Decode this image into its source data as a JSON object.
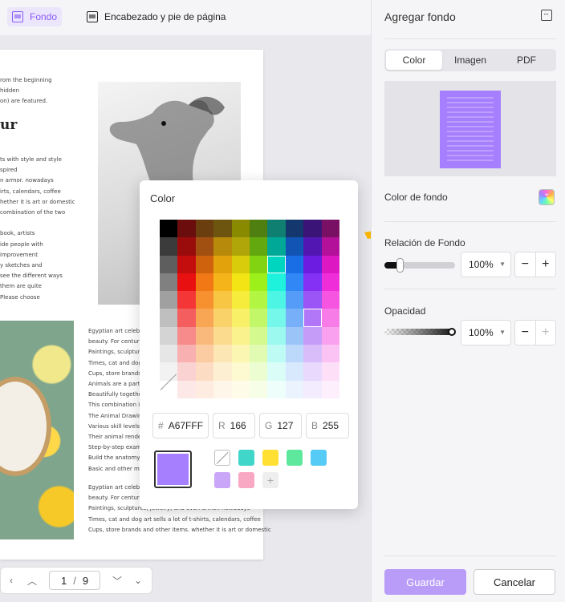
{
  "toolbar": {
    "background_label": "Fondo",
    "header_footer_label": "Encabezado y pie de página"
  },
  "document": {
    "text_top": "rom the beginning\nhidden\non) are featured.",
    "heading": "ur",
    "text_left": "ts with style and style\nspired\nn armor. nowadays\nirts, calendars, coffee\nhether it is art or domestic\ncombination of the two\n\nbook, artists\nide people with\nimprovement\ny sketches and\nsee the different ways\nthem are quite\nPlease choose",
    "text_bottom": "Egyptian art celebrat\nbeauty. For centuries\nPaintings, sculptures\nTimes, cat and dog ar\nCups, store brands ar\nAnimals are a part of\nBeautifully together.\nThis combination is a\nThe Animal Drawing co\nVarious skill levels, s\nTheir animal renderi\nStep-by-step example\nBuild the anatomy of\nBasic and other more",
    "text_footer": "Egyptian art celebrated animals like cats with style and style\nbeauty. For centuries, they have inspired\nPaintings, sculptures, jewelry, and even armor. nowadays\nTimes, cat and dog art sells a lot of t-shirts, calendars, coffee\nCups, store brands and other items. whether it is art or domestic"
  },
  "pager": {
    "current": "1",
    "separator": "/",
    "total": "9"
  },
  "color_popup": {
    "title": "Color",
    "hex_label": "#",
    "hex_value": "A67FFF",
    "r_label": "R",
    "r_value": "166",
    "g_label": "G",
    "g_value": "127",
    "b_label": "B",
    "b_value": "255",
    "selected_color": "#A67FFF",
    "recent_colors": [
      "#40d6c9",
      "#ffe033",
      "#5ee89d",
      "#56cbf5",
      "#c9a6f7",
      "#f9a8c4"
    ],
    "palette": [
      [
        "#000000",
        "#6b0d0d",
        "#6b3e10",
        "#6d5510",
        "#8a8a00",
        "#4f7f10",
        "#0f7f72",
        "#14386e",
        "#3a1476",
        "#7a1063"
      ],
      [
        "#3b3b3b",
        "#9a0c0c",
        "#a15012",
        "#b88a0c",
        "#b0a60a",
        "#63a80f",
        "#00a897",
        "#1254b4",
        "#5216b2",
        "#b3119a"
      ],
      [
        "#5e5e5e",
        "#c40e0e",
        "#cf620c",
        "#e2a20b",
        "#d9cc0a",
        "#82d311",
        "#00d5bf",
        "#196de5",
        "#6b1ce0",
        "#dd17c1"
      ],
      [
        "#808080",
        "#e81010",
        "#f27715",
        "#f5b419",
        "#f2e415",
        "#9ef01b",
        "#1ef2dc",
        "#3187f6",
        "#8431f5",
        "#f02ed9"
      ],
      [
        "#a0a0a0",
        "#f43636",
        "#f7902e",
        "#f8c642",
        "#f6ec3c",
        "#b2f542",
        "#4df6e4",
        "#549cf7",
        "#9b55f6",
        "#f555e1"
      ],
      [
        "#bfbfbf",
        "#f55e5e",
        "#f9a654",
        "#fad26a",
        "#f8f067",
        "#c3f76a",
        "#75f8ea",
        "#77b0f8",
        "#b277f8",
        "#f77ce8"
      ],
      [
        "#d4d4d4",
        "#f78a8a",
        "#fab97c",
        "#fbdc8f",
        "#faf38d",
        "#d3f98f",
        "#9bf9ef",
        "#9bc4f9",
        "#c69cf9",
        "#f9a1ee"
      ],
      [
        "#e6e6e6",
        "#f9b0b0",
        "#fbcba2",
        "#fce6b3",
        "#fbf6b1",
        "#e1fbb3",
        "#bdfbf4",
        "#bcd8fb",
        "#d9bdfb",
        "#fbc3f3"
      ],
      [
        "#f2f2f2",
        "#fbd2d2",
        "#fddcc4",
        "#fdefd2",
        "#fdf9d0",
        "#edfdd2",
        "#dafdf8",
        "#d8e8fd",
        "#e8d9fd",
        "#fde0f8"
      ],
      [
        "none",
        "#fde8e8",
        "#feece0",
        "#fef6e8",
        "#fefce8",
        "#f6fee8",
        "#edfefb",
        "#ebf3fe",
        "#f3ecfe",
        "#feeffc"
      ]
    ]
  },
  "panel": {
    "title": "Agregar fondo",
    "tabs": [
      "Color",
      "Imagen",
      "PDF"
    ],
    "active_tab": "Color",
    "background_color_label": "Color de fondo",
    "ratio_label": "Relación de Fondo",
    "ratio_value": "100%",
    "ratio_fraction": 0.1,
    "opacity_label": "Opacidad",
    "opacity_value": "100%",
    "save_label": "Guardar",
    "cancel_label": "Cancelar",
    "preview_color": "#A67FFF"
  },
  "accent_color": "#8a5cf5",
  "arrow_color": "#f7b500"
}
